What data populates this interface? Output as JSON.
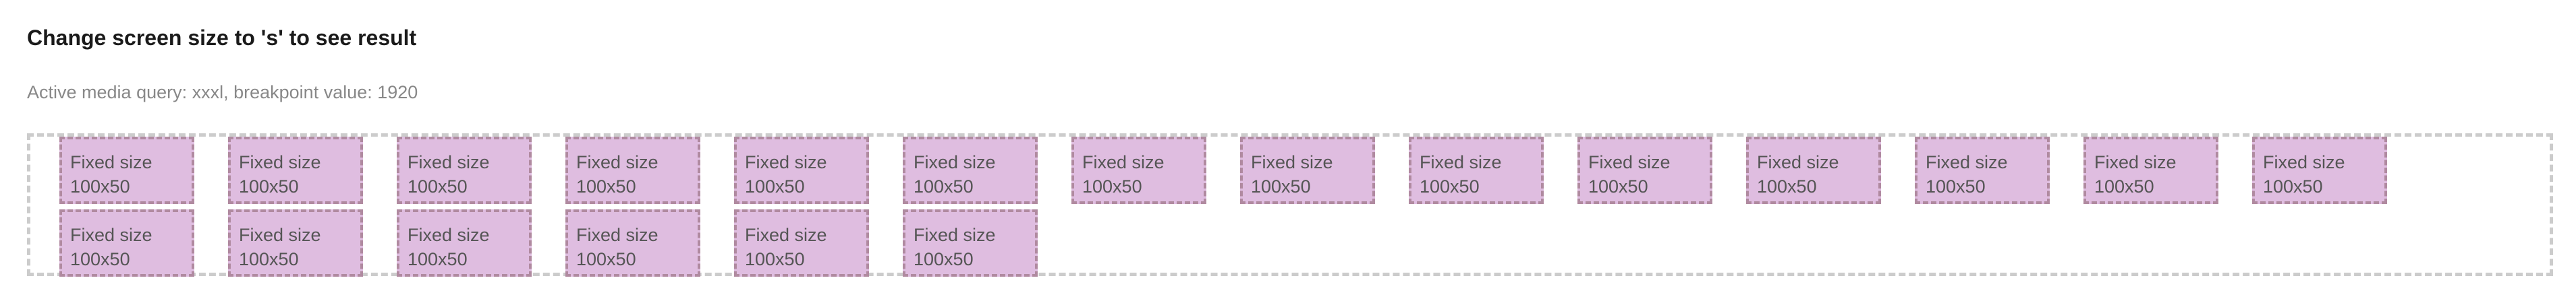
{
  "header": {
    "title": "Change screen size to 's' to see result",
    "status": "Active media query: xxxl, breakpoint value: 1920"
  },
  "grid": {
    "items": [
      {
        "line1": "Fixed size",
        "line2": "100x50"
      },
      {
        "line1": "Fixed size",
        "line2": "100x50"
      },
      {
        "line1": "Fixed size",
        "line2": "100x50"
      },
      {
        "line1": "Fixed size",
        "line2": "100x50"
      },
      {
        "line1": "Fixed size",
        "line2": "100x50"
      },
      {
        "line1": "Fixed size",
        "line2": "100x50"
      },
      {
        "line1": "Fixed size",
        "line2": "100x50"
      },
      {
        "line1": "Fixed size",
        "line2": "100x50"
      },
      {
        "line1": "Fixed size",
        "line2": "100x50"
      },
      {
        "line1": "Fixed size",
        "line2": "100x50"
      },
      {
        "line1": "Fixed size",
        "line2": "100x50"
      },
      {
        "line1": "Fixed size",
        "line2": "100x50"
      },
      {
        "line1": "Fixed size",
        "line2": "100x50"
      },
      {
        "line1": "Fixed size",
        "line2": "100x50"
      },
      {
        "line1": "Fixed size",
        "line2": "100x50"
      },
      {
        "line1": "Fixed size",
        "line2": "100x50"
      },
      {
        "line1": "Fixed size",
        "line2": "100x50"
      },
      {
        "line1": "Fixed size",
        "line2": "100x50"
      },
      {
        "line1": "Fixed size",
        "line2": "100x50"
      },
      {
        "line1": "Fixed size",
        "line2": "100x50"
      }
    ]
  },
  "colors": {
    "box_fill": "#dfbde0",
    "box_border": "#b08aa0",
    "container_border": "#cccccc"
  }
}
